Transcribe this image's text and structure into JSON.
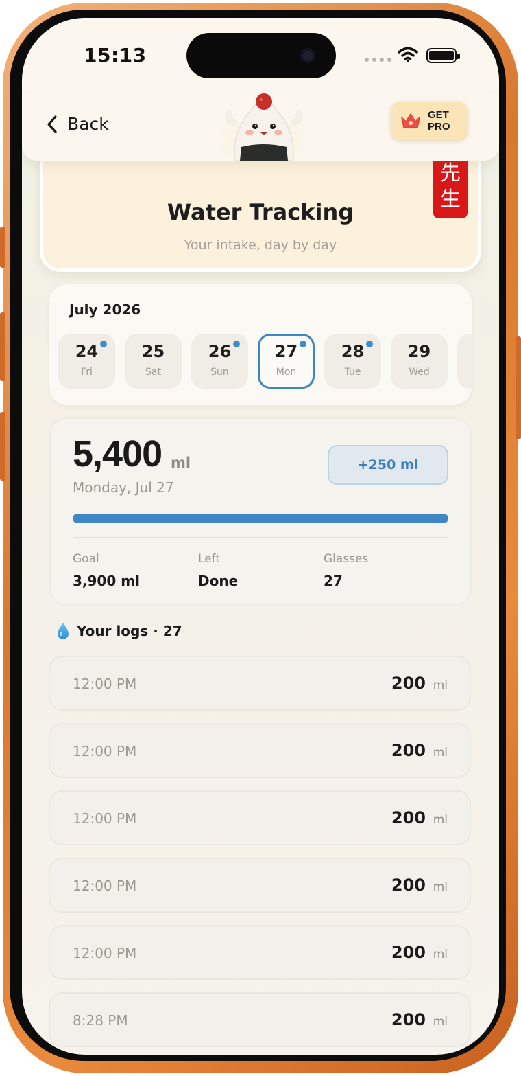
{
  "status_bar": {
    "time": "15:13"
  },
  "header": {
    "back_label": "Back",
    "pro_line1": "GET",
    "pro_line2": "PRO"
  },
  "title_card": {
    "title": "Water Tracking",
    "subtitle": "Your intake, day by day",
    "stamp": "先生"
  },
  "calendar": {
    "month": "July 2026",
    "days": [
      {
        "num": "24",
        "name": "Fri",
        "logged": true,
        "selected": false
      },
      {
        "num": "25",
        "name": "Sat",
        "logged": false,
        "selected": false
      },
      {
        "num": "26",
        "name": "Sun",
        "logged": true,
        "selected": false
      },
      {
        "num": "27",
        "name": "Mon",
        "logged": true,
        "selected": true
      },
      {
        "num": "28",
        "name": "Tue",
        "logged": true,
        "selected": false
      },
      {
        "num": "29",
        "name": "Wed",
        "logged": false,
        "selected": false
      }
    ]
  },
  "summary": {
    "total": "5,400",
    "unit": "ml",
    "date": "Monday, Jul 27",
    "add_button": "+250 ml",
    "progress_percent": 100,
    "goal_label": "Goal",
    "goal_value": "3,900 ml",
    "left_label": "Left",
    "left_value": "Done",
    "glasses_label": "Glasses",
    "glasses_value": "27"
  },
  "logs": {
    "title": "Your logs · 27",
    "items": [
      {
        "time": "12:00 PM",
        "amount": "200",
        "unit": "ml"
      },
      {
        "time": "12:00 PM",
        "amount": "200",
        "unit": "ml"
      },
      {
        "time": "12:00 PM",
        "amount": "200",
        "unit": "ml"
      },
      {
        "time": "12:00 PM",
        "amount": "200",
        "unit": "ml"
      },
      {
        "time": "12:00 PM",
        "amount": "200",
        "unit": "ml"
      },
      {
        "time": "8:28 PM",
        "amount": "200",
        "unit": "ml"
      }
    ]
  },
  "colors": {
    "accent": "#3f86c4",
    "stamp_red": "#d81818",
    "frame_orange": "#d9782f"
  }
}
